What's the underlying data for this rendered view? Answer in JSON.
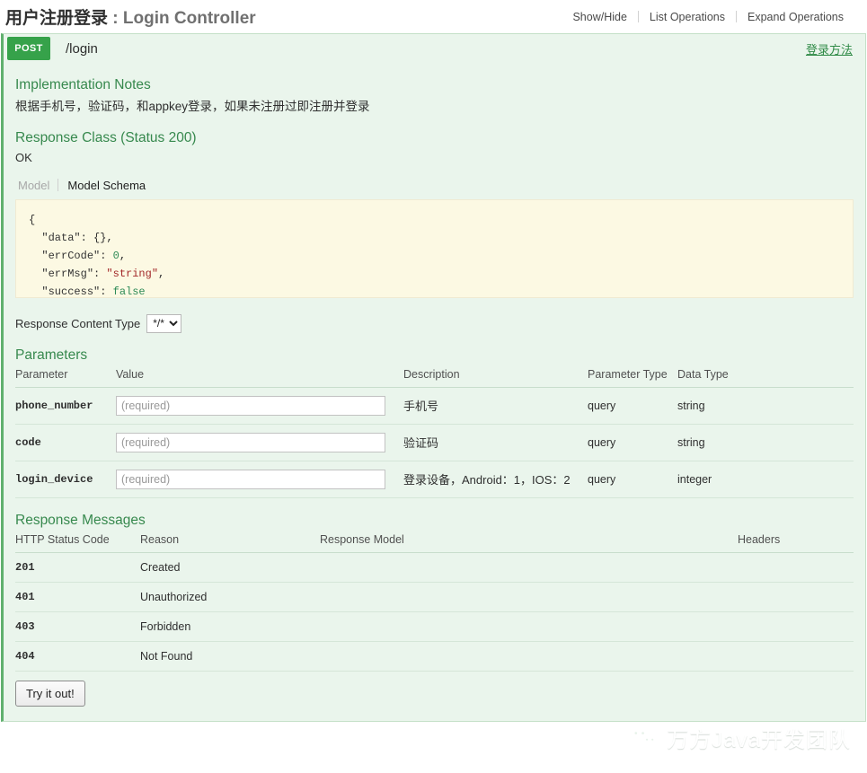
{
  "header": {
    "title_cn": "用户注册登录",
    "separator": " : ",
    "title_en": "Login Controller",
    "links": [
      {
        "label": "Show/Hide"
      },
      {
        "label": "List Operations"
      },
      {
        "label": "Expand Operations"
      }
    ]
  },
  "operation": {
    "method": "POST",
    "path": "/login",
    "summary": "登录方法",
    "implementation_notes_heading": "Implementation Notes",
    "implementation_notes": "根据手机号，验证码，和appkey登录，如果未注册过即注册并登录",
    "response_class_heading": "Response Class (Status 200)",
    "response_class_description": "OK",
    "model_tabs": [
      {
        "label": "Model",
        "active": false
      },
      {
        "label": "Model Schema",
        "active": true
      }
    ],
    "schema": {
      "open_brace": "{",
      "lines": [
        {
          "key": "\"data\"",
          "value": "{}",
          "kind": "plain",
          "comma": ","
        },
        {
          "key": "\"errCode\"",
          "value": "0",
          "kind": "num",
          "comma": ","
        },
        {
          "key": "\"errMsg\"",
          "value": "\"string\"",
          "kind": "str",
          "comma": ","
        },
        {
          "key": "\"success\"",
          "value": "false",
          "kind": "bool",
          "comma": ""
        }
      ],
      "close_brace": "}"
    },
    "content_type": {
      "label": "Response Content Type",
      "selected": "*/*",
      "options": [
        "*/*"
      ]
    },
    "parameters_heading": "Parameters",
    "parameters_columns": [
      "Parameter",
      "Value",
      "Description",
      "Parameter Type",
      "Data Type"
    ],
    "parameters": [
      {
        "name": "phone_number",
        "value": "",
        "placeholder": "(required)",
        "description": "手机号",
        "parameter_type": "query",
        "data_type": "string"
      },
      {
        "name": "code",
        "value": "",
        "placeholder": "(required)",
        "description": "验证码",
        "parameter_type": "query",
        "data_type": "string"
      },
      {
        "name": "login_device",
        "value": "",
        "placeholder": "(required)",
        "description": "登录设备，Android：1，IOS：2",
        "parameter_type": "query",
        "data_type": "integer"
      }
    ],
    "response_messages_heading": "Response Messages",
    "response_columns": [
      "HTTP Status Code",
      "Reason",
      "Response Model",
      "Headers"
    ],
    "response_messages": [
      {
        "code": "201",
        "reason": "Created",
        "model": "",
        "headers": ""
      },
      {
        "code": "401",
        "reason": "Unauthorized",
        "model": "",
        "headers": ""
      },
      {
        "code": "403",
        "reason": "Forbidden",
        "model": "",
        "headers": ""
      },
      {
        "code": "404",
        "reason": "Not Found",
        "model": "",
        "headers": ""
      }
    ],
    "submit_label": "Try it out!"
  },
  "watermark": {
    "text": "万方Java开发团队",
    "icon": "wechat-icon"
  },
  "colors": {
    "method_post": "#36a24a",
    "panel_bg": "#eaf5ec",
    "heading_green": "#37894e",
    "schema_bg": "#fcf9e3"
  }
}
